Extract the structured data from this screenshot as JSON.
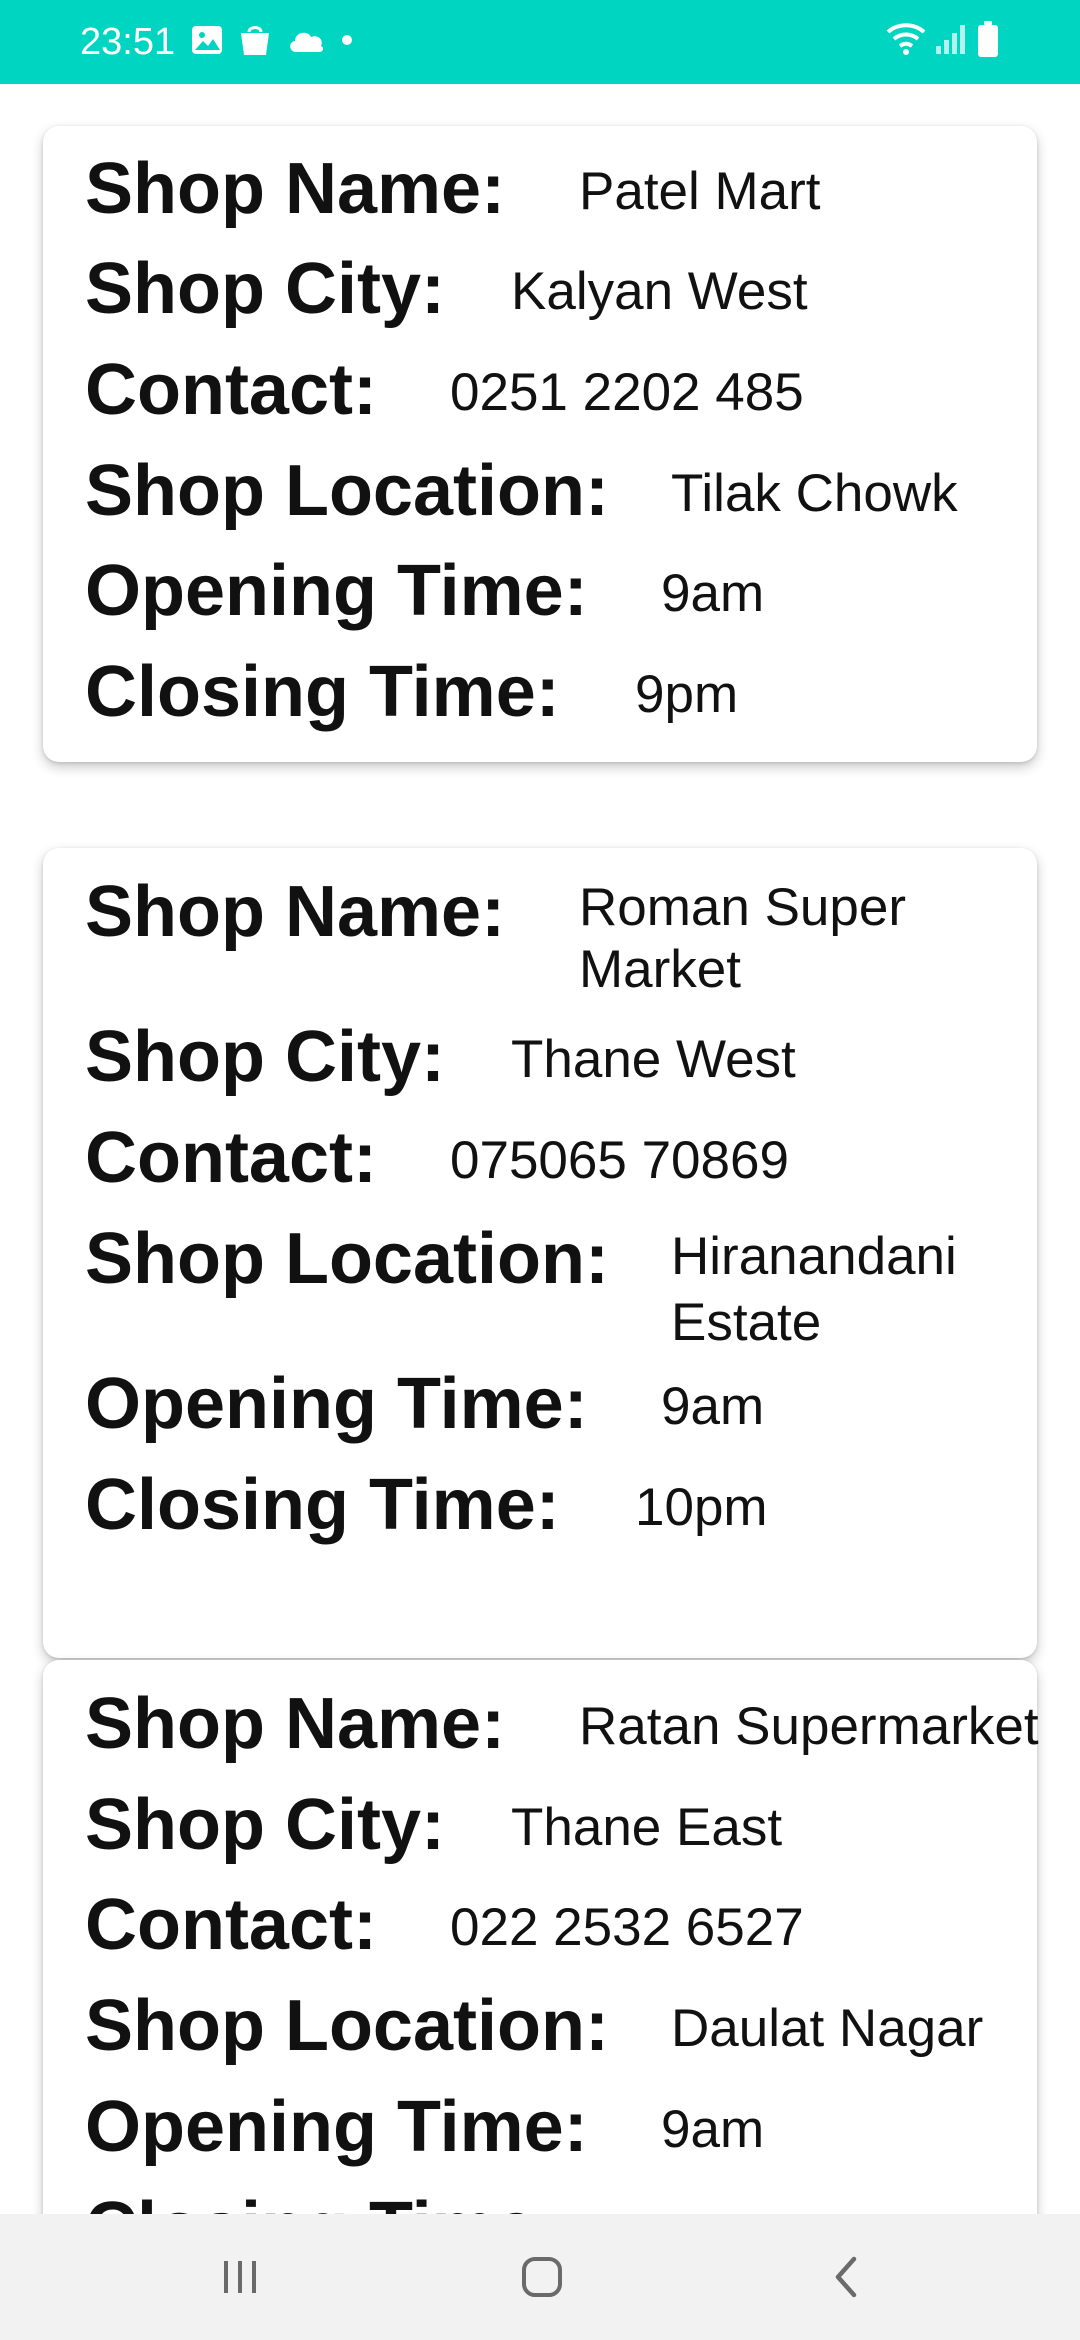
{
  "status_bar": {
    "time": "23:51",
    "left_icons": [
      "image-icon",
      "shopping-bag-icon",
      "cloud-icon",
      "dot-icon"
    ],
    "right_icons": [
      "wifi-icon",
      "signal-icon",
      "battery-icon"
    ],
    "color": "#00d5c2"
  },
  "labels": {
    "shop_name": "Shop Name:",
    "shop_city": "Shop City:",
    "contact": "Contact:",
    "shop_location": "Shop Location:",
    "opening_time": "Opening Time:",
    "closing_time": "Closing Time:"
  },
  "shops": [
    {
      "name": "Patel Mart",
      "city": "Kalyan West",
      "contact": "0251 2202 485",
      "location": "Tilak Chowk",
      "opening": "9am",
      "closing": "9pm"
    },
    {
      "name": "Roman Super Market",
      "city": "Thane West",
      "contact": "075065 70869",
      "location": "Hiranandani Estate",
      "opening": "9am",
      "closing": "10pm"
    },
    {
      "name": "Ratan Supermarket",
      "city": "Thane East",
      "contact": "022 2532 6527",
      "location": "Daulat Nagar",
      "opening": "9am",
      "closing": ""
    }
  ],
  "nav_bar": {
    "buttons": [
      "recent-apps-icon",
      "home-icon",
      "back-icon"
    ]
  }
}
